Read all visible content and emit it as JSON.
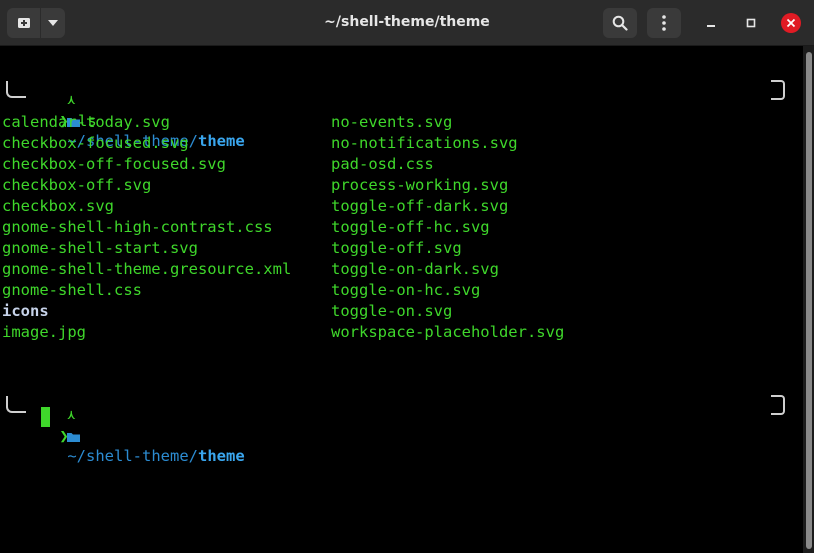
{
  "window": {
    "title": "~/shell-theme/theme"
  },
  "headerbar": {
    "icons": [
      "new-tab-icon",
      "chevron-down-icon",
      "search-icon",
      "kebab-menu-icon",
      "minimize-icon",
      "maximize-icon",
      "close-icon"
    ],
    "close_color": "#e01b24"
  },
  "prompt1": {
    "tilde": "~",
    "path_prefix": "/shell-theme/",
    "path_current": "theme",
    "arrow": "❯",
    "command": "ls"
  },
  "listing": {
    "col1": [
      "calendar-today.svg",
      "checkbox-focused.svg",
      "checkbox-off-focused.svg",
      "checkbox-off.svg",
      "checkbox.svg",
      "gnome-shell-high-contrast.css",
      "gnome-shell-start.svg",
      "gnome-shell-theme.gresource.xml",
      "gnome-shell.css",
      "icons",
      "image.jpg"
    ],
    "col2": [
      "no-events.svg",
      "no-notifications.svg",
      "pad-osd.css",
      "process-working.svg",
      "toggle-off-dark.svg",
      "toggle-off-hc.svg",
      "toggle-off.svg",
      "toggle-on-dark.svg",
      "toggle-on-hc.svg",
      "toggle-on.svg",
      "workspace-placeholder.svg"
    ]
  },
  "prompt2": {
    "tilde": "~",
    "path_prefix": "/shell-theme/",
    "path_current": "theme",
    "arrow": "❯"
  },
  "colors": {
    "text_green": "#3fd72b",
    "path_blue": "#2c8cd2",
    "dir_color": "#c7d3ea",
    "background": "#000000"
  }
}
